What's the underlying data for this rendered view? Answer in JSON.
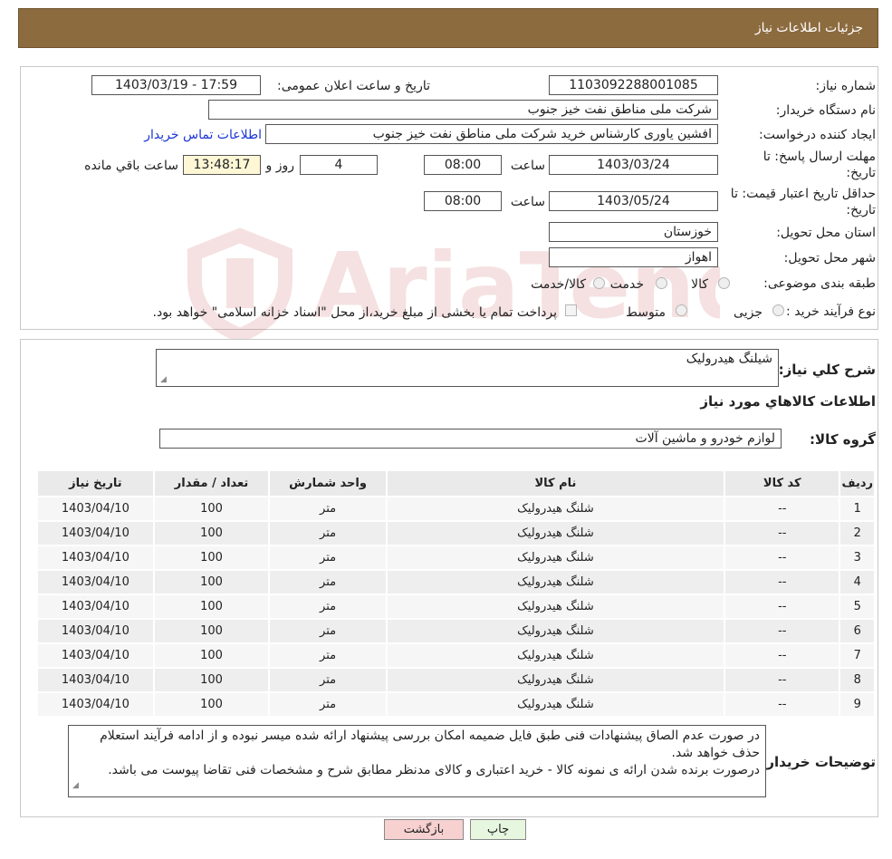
{
  "header": {
    "title": "جزئیات اطلاعات نیاز"
  },
  "form": {
    "need_number_label": "شماره نیاز:",
    "need_number": "1103092288001085",
    "announce_label": "تاریخ و ساعت اعلان عمومی:",
    "announce_value": "1403/03/19 - 17:59",
    "buyer_org_label": "نام دستگاه خریدار:",
    "buyer_org": "شرکت ملی مناطق نفت خیز جنوب",
    "creator_label": "ایجاد کننده درخواست:",
    "creator": "افشین  یاوری  کارشناس خرید  شرکت ملی مناطق نفت خیز جنوب",
    "contact_link": "اطلاعات تماس خریدار",
    "deadline_label_1": "مهلت ارسال پاسخ: تا",
    "deadline_label_2": "تاریخ:",
    "deadline_date": "1403/03/24",
    "time_label": "ساعت",
    "deadline_time": "08:00",
    "days_remaining": "4",
    "days_label": "روز و",
    "countdown": "13:48:17",
    "remaining_label": "ساعت باقي مانده",
    "validity_label_1": "حداقل تاریخ اعتبار قیمت: تا",
    "validity_label_2": "تاریخ:",
    "validity_date": "1403/05/24",
    "validity_time": "08:00",
    "province_label": "استان محل تحویل:",
    "province": "خوزستان",
    "city_label": "شهر محل تحویل:",
    "city": "اهواز",
    "category_label": "طبقه بندی موضوعی:",
    "category_options": [
      "کالا",
      "خدمت",
      "کالا/خدمت"
    ],
    "process_label": "نوع فرآیند خرید :",
    "process_options": [
      "جزیی",
      "متوسط"
    ],
    "payment_note": "پرداخت تمام یا بخشی از مبلغ خرید،از محل \"اسناد خزانه اسلامی\" خواهد بود."
  },
  "details": {
    "summary_label": "شرح کلي نياز:",
    "summary": "شیلنگ هیدرولیک",
    "goods_title": "اطلاعات کالاهاي مورد نياز",
    "group_label": "گروه کالا:",
    "group": "لوازم خودرو و ماشین آلات"
  },
  "table": {
    "headers": [
      "رديف",
      "کد کالا",
      "نام کالا",
      "واحد شمارش",
      "تعداد / مقدار",
      "تاريخ نياز"
    ],
    "rows": [
      [
        "1",
        "--",
        "شلنگ هیدرولیک",
        "متر",
        "100",
        "1403/04/10"
      ],
      [
        "2",
        "--",
        "شلنگ هیدرولیک",
        "متر",
        "100",
        "1403/04/10"
      ],
      [
        "3",
        "--",
        "شلنگ هیدرولیک",
        "متر",
        "100",
        "1403/04/10"
      ],
      [
        "4",
        "--",
        "شلنگ هیدرولیک",
        "متر",
        "100",
        "1403/04/10"
      ],
      [
        "5",
        "--",
        "شلنگ هیدرولیک",
        "متر",
        "100",
        "1403/04/10"
      ],
      [
        "6",
        "--",
        "شلنگ هیدرولیک",
        "متر",
        "100",
        "1403/04/10"
      ],
      [
        "7",
        "--",
        "شلنگ هیدرولیک",
        "متر",
        "100",
        "1403/04/10"
      ],
      [
        "8",
        "--",
        "شلنگ هیدرولیک",
        "متر",
        "100",
        "1403/04/10"
      ],
      [
        "9",
        "--",
        "شلنگ هیدرولیک",
        "متر",
        "100",
        "1403/04/10"
      ]
    ]
  },
  "buyer_notes": {
    "label": "توضیحات خریدار:",
    "text": "در صورت عدم الصاق پیشنهادات فنی طبق فایل ضمیمه امکان بررسی پیشنهاد ارائه شده میسر نبوده و از ادامه فرآیند استعلام حذف خواهد شد.\nدرصورت برنده شدن ارائه ی نمونه کالا - خرید اعتباری و کالای مدنظر مطابق شرح و مشخصات فنی تقاضا پیوست می باشد."
  },
  "buttons": {
    "print": "چاپ",
    "back": "بازگشت"
  },
  "watermark": {
    "text": "AriaTender.neT"
  },
  "icons": {
    "resize": "resize-handle-icon",
    "logo": "ariatender-logo-icon"
  },
  "colors": {
    "header": "#8c6b3f",
    "link": "#1a35d6",
    "back_button": "#f7d0d0",
    "print_button": "#e7f7df",
    "countdown_bg": "#fdf7d6"
  }
}
